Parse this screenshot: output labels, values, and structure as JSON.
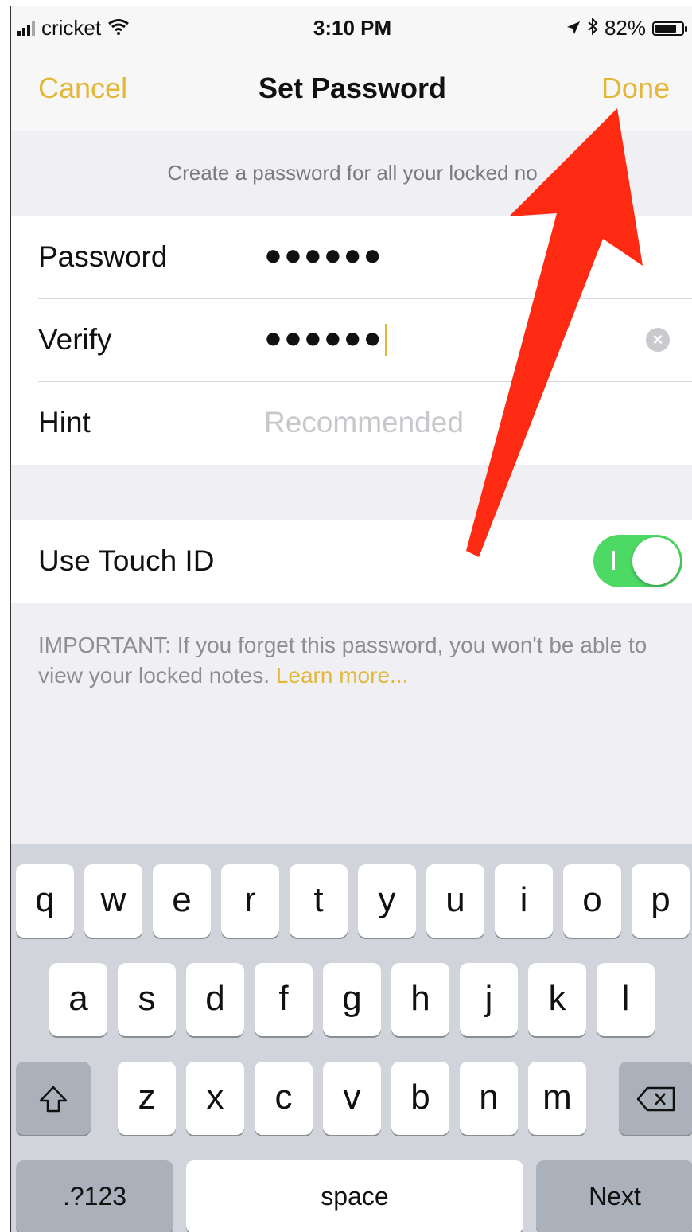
{
  "status_bar": {
    "carrier": "cricket",
    "time": "3:10 PM",
    "battery": "82%",
    "battery_level": 0.82
  },
  "nav": {
    "cancel_label": "Cancel",
    "title": "Set Password",
    "done_label": "Done"
  },
  "caption": "Create a password for all your locked no",
  "form": {
    "password_label": "Password",
    "password_value": "●●●●●●",
    "verify_label": "Verify",
    "verify_value": "●●●●●●",
    "hint_label": "Hint",
    "hint_placeholder": "Recommended"
  },
  "touch_id": {
    "label": "Use Touch ID",
    "enabled": true
  },
  "important": {
    "text": "IMPORTANT: If you forget this password, you won't be able to view your locked notes.",
    "link": "Learn more..."
  },
  "keyboard": {
    "row1": [
      "q",
      "w",
      "e",
      "r",
      "t",
      "y",
      "u",
      "i",
      "o",
      "p"
    ],
    "row2": [
      "a",
      "s",
      "d",
      "f",
      "g",
      "h",
      "j",
      "k",
      "l"
    ],
    "row3": [
      "z",
      "x",
      "c",
      "v",
      "b",
      "n",
      "m"
    ],
    "numbers_label": ".?123",
    "space_label": "space",
    "next_label": "Next"
  },
  "colors": {
    "accent": "#e3b83a",
    "toggle_on": "#4cd964",
    "annotation_arrow": "#ff2a12"
  }
}
